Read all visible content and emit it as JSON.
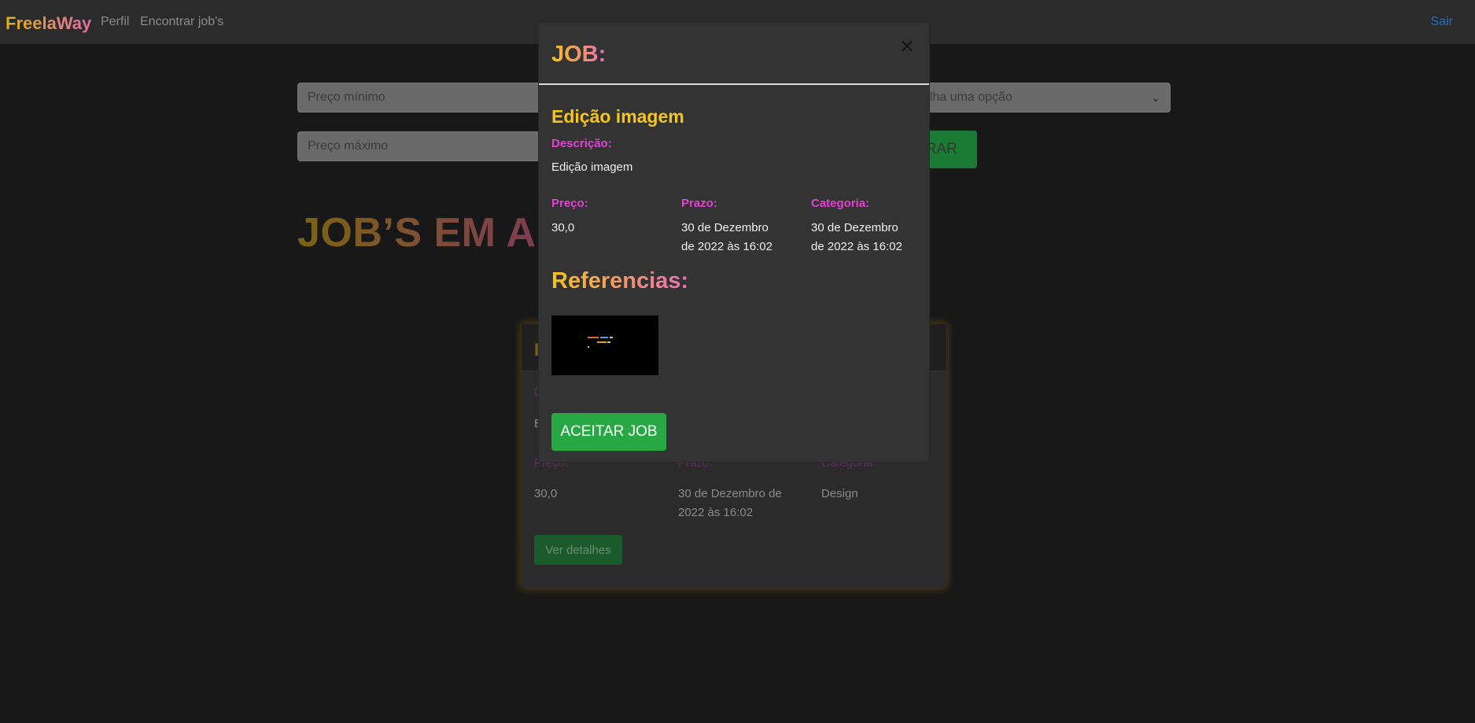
{
  "navbar": {
    "brand": "FreelaWay",
    "links": [
      "Perfil",
      "Encontrar job's"
    ],
    "logout": "Sair"
  },
  "filters": {
    "min_price_placeholder": "Preço mínimo",
    "max_price_placeholder": "Preço máximo",
    "category_select_value": "olha uma opção",
    "filter_button": "TRAR"
  },
  "page": {
    "section_title": "JOB’S EM AI"
  },
  "card": {
    "header_partial": "I",
    "description_label": "D",
    "description_value": "E",
    "preco_label": "Preço:",
    "prazo_label": "Prazo:",
    "categoria_label": "Categoria:",
    "preco_value": "30,0",
    "prazo_value": "30 de Dezembro de 2022 às 16:02",
    "categoria_value": "Design",
    "details_button": "Ver detalhes"
  },
  "modal": {
    "title": "JOB:",
    "close_symbol": "×",
    "job_name": "Edição imagem",
    "description_label": "Descrição:",
    "description_value": "Edição imagem",
    "preco_label": "Preço:",
    "prazo_label": "Prazo:",
    "categoria_label": "Categoria:",
    "preco_value": "30,0",
    "prazo_value": "30 de Dezembro de 2022 às 16:02",
    "categoria_value": "30 de Dezembro de 2022 às 16:02",
    "references_title": "Referencias:",
    "accept_button": "ACEITAR JOB"
  },
  "colors": {
    "page_bg": "#181818",
    "navbar_bg": "#2b2b2b",
    "modal_bg": "#333333",
    "accent_gold": "#f4c51f",
    "accent_pink": "#e042d2",
    "success": "#28a745",
    "link_blue": "#1f6fc8"
  },
  "icons": {
    "close": "close-icon",
    "select_chevron": "chevron-down-icon"
  }
}
